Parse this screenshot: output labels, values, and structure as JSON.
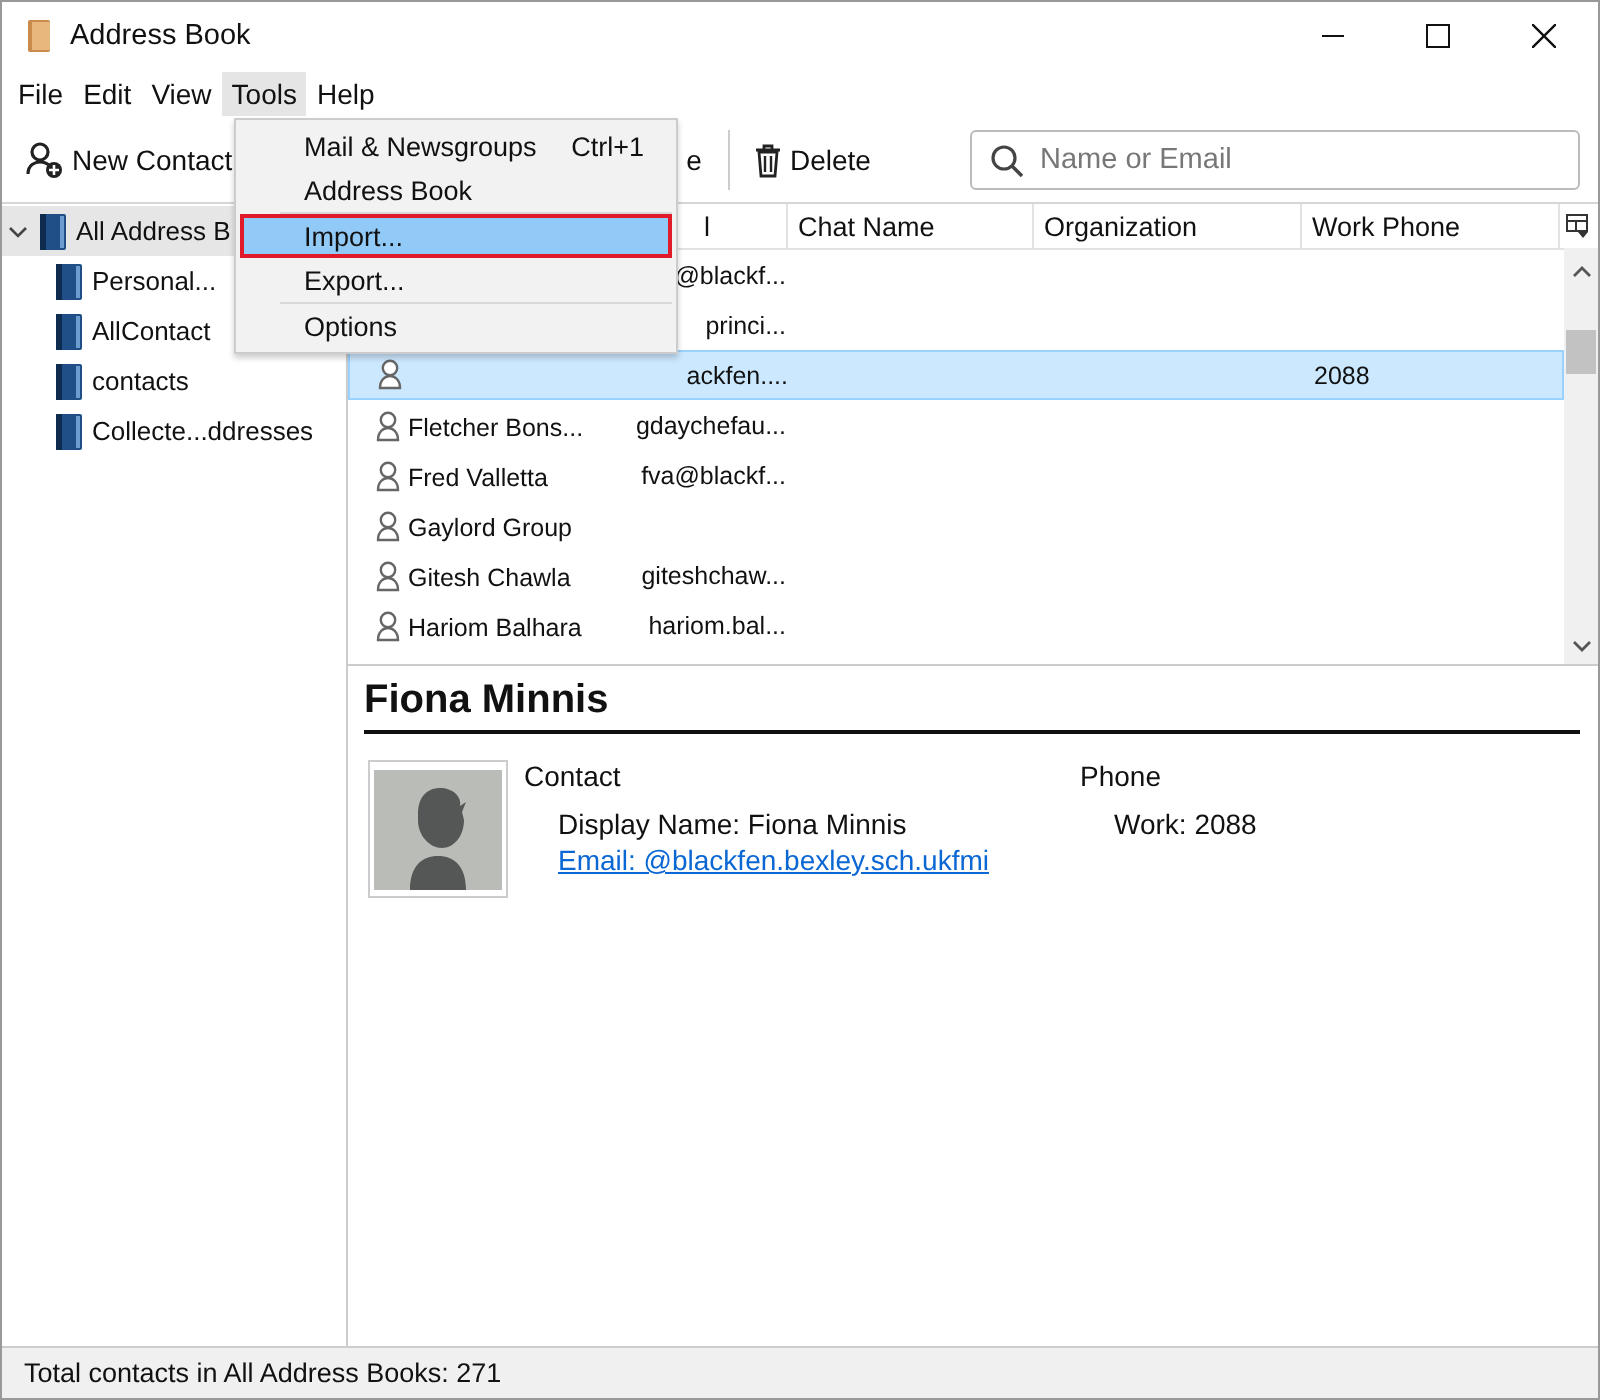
{
  "window": {
    "title": "Address Book"
  },
  "menu_bar": [
    {
      "label": "File",
      "selected": false
    },
    {
      "label": "Edit",
      "selected": false
    },
    {
      "label": "View",
      "selected": false
    },
    {
      "label": "Tools",
      "selected": true
    },
    {
      "label": "Help",
      "selected": false
    }
  ],
  "toolbar": {
    "buttons": [
      {
        "kind": "new-contact",
        "label": "New Contact"
      },
      {
        "kind": "hidden",
        "label": "e"
      },
      {
        "kind": "delete",
        "label": "Delete"
      }
    ],
    "search": {
      "placeholder": "Name or Email"
    }
  },
  "sidebar": {
    "items": [
      {
        "label": "All Address B",
        "selected": true,
        "expanded": true,
        "children": [
          {
            "label": "Personal...",
            "selected": false
          },
          {
            "label": "AllContact",
            "selected": false
          },
          {
            "label": "contacts",
            "selected": false
          },
          {
            "label": "Collecte...ddresses",
            "selected": false
          }
        ]
      }
    ]
  },
  "table": {
    "columns": [
      {},
      {
        "label": "l"
      },
      {
        "label": "Chat Name"
      },
      {
        "label": "Organization"
      },
      {
        "label": "Work Phone"
      }
    ],
    "rows": [
      {
        "email": "@blackf...",
        "selected": false,
        "icon": false
      },
      {
        "email": "princi...",
        "selected": false,
        "icon": false
      },
      {
        "email": "ackfen....",
        "work_phone": "2088",
        "selected": true,
        "icon": true
      },
      {
        "name": "Fletcher Bons...",
        "email": "gdaychefau...",
        "selected": false,
        "icon": true
      },
      {
        "name": "Fred  Valletta",
        "email": "fva@blackf...",
        "selected": false,
        "icon": true
      },
      {
        "name": "Gaylord Group",
        "selected": false,
        "icon": true
      },
      {
        "name": "Gitesh Chawla",
        "email": "giteshchaw...",
        "selected": false,
        "icon": true
      },
      {
        "name": "Hariom Balhara",
        "email": "hariom.bal...",
        "selected": false,
        "icon": true
      }
    ]
  },
  "tools_menu": {
    "items": [
      {
        "kind": "item",
        "label": "Mail & Newsgroups",
        "shortcut": "Ctrl+1",
        "selected": false
      },
      {
        "kind": "item",
        "label": "Address Book",
        "selected": false
      },
      {
        "kind": "separator"
      },
      {
        "kind": "item",
        "label": "Import...",
        "selected": true
      },
      {
        "kind": "item",
        "label": "Export...",
        "selected": false
      },
      {
        "kind": "separator"
      },
      {
        "kind": "item",
        "label": "Options",
        "selected": false
      }
    ]
  },
  "contact_card": {
    "name": "Fiona Minnis",
    "sections": [
      {
        "heading": "Contact",
        "lines": [
          {
            "kind": "text",
            "text": "Display Name: Fiona Minnis"
          },
          {
            "kind": "link",
            "text": "Email: @blackfen.bexley.sch.ukfmi"
          }
        ]
      },
      {
        "heading": "Phone",
        "lines": [
          {
            "kind": "text",
            "text": "Work: 2088"
          }
        ]
      }
    ]
  },
  "status_bar": "Total contacts in All Address Books: 271"
}
